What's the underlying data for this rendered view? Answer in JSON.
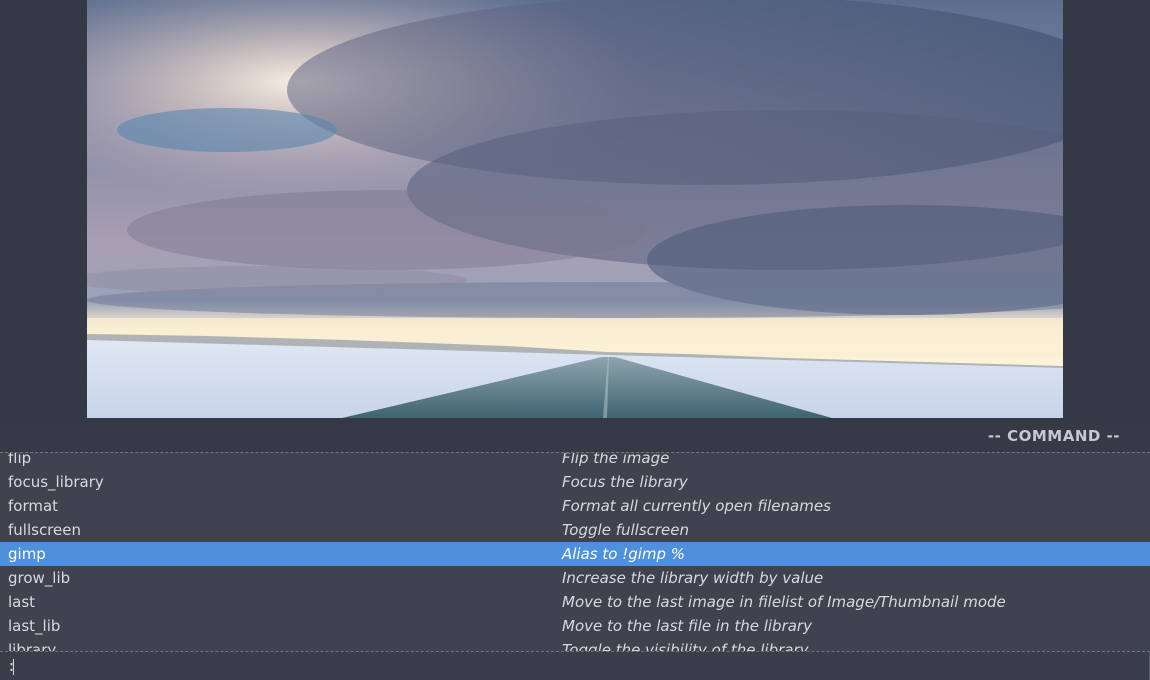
{
  "viewer": {
    "image_subject": "Winter ice road under a cloudy sky"
  },
  "statusbar": {
    "mode": "-- COMMAND --"
  },
  "completion": {
    "selected_index": 4,
    "rows": [
      {
        "command": "flip",
        "description": "Flip the image"
      },
      {
        "command": "focus_library",
        "description": "Focus the library"
      },
      {
        "command": "format",
        "description": "Format all currently open filenames"
      },
      {
        "command": "fullscreen",
        "description": "Toggle fullscreen"
      },
      {
        "command": "gimp",
        "description": "Alias to !gimp %"
      },
      {
        "command": "grow_lib",
        "description": "Increase the library width by value"
      },
      {
        "command": "last",
        "description": "Move to the last image in filelist of Image/Thumbnail mode"
      },
      {
        "command": "last_lib",
        "description": "Move to the last file in the library"
      },
      {
        "command": "library",
        "description": "Toggle the visibility of the library"
      }
    ]
  },
  "commandline": {
    "prompt": ":",
    "value": ""
  },
  "colors": {
    "background": "#363a46",
    "completion_bg": "#3f4350",
    "selection": "#4e90dc",
    "text": "#d7d9df"
  }
}
